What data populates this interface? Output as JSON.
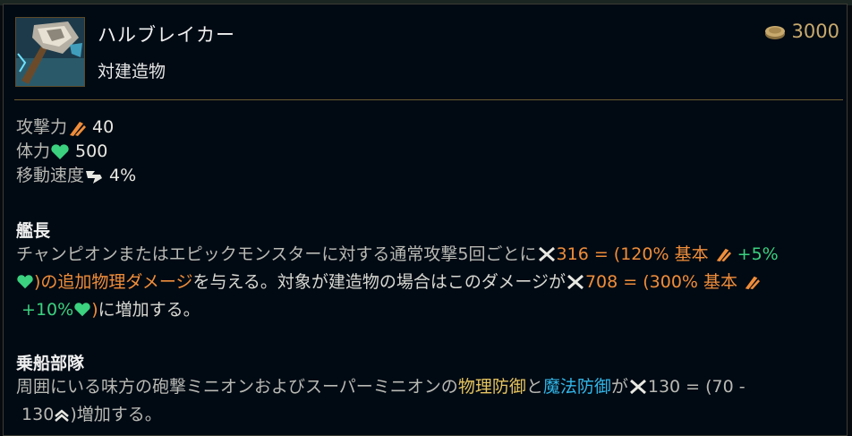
{
  "item": {
    "name": "ハルブレイカー",
    "tag": "対建造物",
    "cost": "3000"
  },
  "stats": [
    {
      "label": "攻撃力",
      "icon": "attack-damage-icon",
      "value": "40"
    },
    {
      "label": "体力",
      "icon": "health-icon",
      "value": "500"
    },
    {
      "label": "移動速度",
      "icon": "movement-speed-icon",
      "value": "4%"
    }
  ],
  "passive1": {
    "title": "艦長",
    "line1_text": "チャンピオンまたはエピックモンスターに対する通常攻撃5回ごとに",
    "line1_dmg": "316 = (120% 基本",
    "line1_bonus": "+5%",
    "line2_close": ")",
    "line2_orange": "の追加物理ダメージ",
    "line2_text": "を与える。対象が建造物の場合はこのダメージが",
    "line2_dmg": "708 = (300% 基本",
    "line3_bonus": "+10%",
    "line3_close": ")",
    "line3_text": "に増加する。"
  },
  "passive2": {
    "title": "乗船部隊",
    "line1_text": "周囲にいる味方の砲撃ミニオンおよびスーパーミニオンの",
    "line1_armor": "物理防御",
    "line1_and": "と",
    "line1_mr": "魔法防御",
    "line1_ga": "が",
    "line1_val": "130 = (70 -",
    "line2_val": "130",
    "line2_text": ")増加する。"
  },
  "colors": {
    "damage": "#f08d3a",
    "health": "#3bd17f",
    "armor": "#e6c45f",
    "magic_resist": "#32b6e8",
    "gold": "#c8aa6e"
  }
}
